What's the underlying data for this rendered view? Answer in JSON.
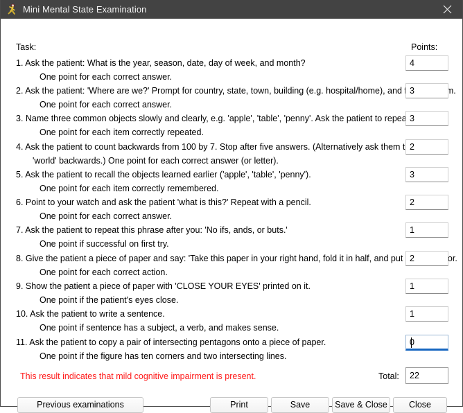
{
  "window": {
    "title": "Mini Mental State Examination",
    "icon": "runner-figure-icon",
    "close_icon": "close-icon",
    "titlebar_color": "#434343",
    "border_color": "#4a4a4a"
  },
  "headers": {
    "task": "Task:",
    "points": "Points:"
  },
  "tasks": [
    {
      "main": "1. Ask the patient: What is the year, season, date, day of week, and month?",
      "main2": "",
      "sub": "One point for each correct answer.",
      "points": "4"
    },
    {
      "main": "2. Ask the patient: 'Where are we?' Prompt for country, state, town, building (e.g. hospital/home), and floor or room.",
      "main2": "",
      "sub": "One point for each correct answer.",
      "points": "3"
    },
    {
      "main": "3. Name three common objects slowly and clearly, e.g. 'apple', 'table', 'penny'. Ask the patient to repeat them.",
      "main2": "",
      "sub": "One point for each item correctly repeated.",
      "points": "3"
    },
    {
      "main": "4. Ask the patient to count backwards from 100 by 7. Stop after five answers. (Alternatively ask them to spell",
      "main2": "'world' backwards.)  One point for each correct answer (or letter).",
      "sub": "",
      "points": "2"
    },
    {
      "main": "5. Ask the patient to recall the objects learned earlier ('apple', 'table', 'penny').",
      "main2": "",
      "sub": "One point for each item correctly remembered.",
      "points": "3"
    },
    {
      "main": "6. Point to your watch and ask the patient 'what is this?'  Repeat with a pencil.",
      "main2": "",
      "sub": "One point for each correct answer.",
      "points": "2"
    },
    {
      "main": "7. Ask the patient to repeat this phrase after you: 'No ifs, ands, or buts.'",
      "main2": "",
      "sub": "One point if successful on first try.",
      "points": "1"
    },
    {
      "main": "8. Give the patient a piece of paper and say: 'Take this paper in your right hand, fold it in half, and put it on the floor.",
      "main2": "",
      "sub": "One point for each correct action.",
      "points": "2"
    },
    {
      "main": "9. Show the patient a piece of paper with 'CLOSE YOUR EYES' printed on it.",
      "main2": "",
      "sub": "One point if the patient's eyes close.",
      "points": "1"
    },
    {
      "main": "10. Ask the patient to write a sentence.",
      "main2": "",
      "sub": "One point if sentence has a subject, a verb, and makes sense.",
      "points": "1"
    },
    {
      "main": "11. Ask the patient to copy a pair of intersecting pentagons onto a piece of paper.",
      "main2": "",
      "sub": "One point if the figure has ten corners and two intersecting lines.",
      "points": "0",
      "focused": true
    }
  ],
  "result": {
    "message": "This result indicates that mild cognitive impairment is present.",
    "message_color": "#ff1a1a"
  },
  "total": {
    "label": "Total:",
    "value": "22"
  },
  "buttons": {
    "previous_examinations": "Previous examinations",
    "print": "Print",
    "save": "Save",
    "save_and_close": "Save & Close",
    "close": "Close"
  }
}
